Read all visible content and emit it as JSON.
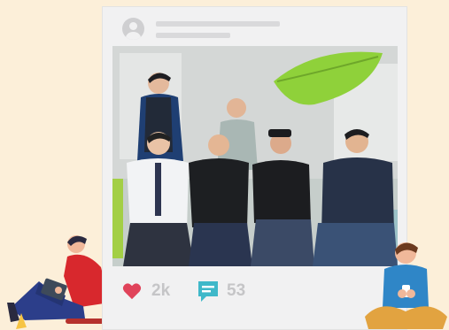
{
  "post": {
    "likes": "2k",
    "comments": "53"
  },
  "icons": {
    "avatar": "user-avatar-icon",
    "like": "heart-icon",
    "comment": "comment-icon"
  },
  "colors": {
    "background": "#fcefd9",
    "card": "#f1f1f2",
    "heart": "#e0435a",
    "comment": "#3fb8c9",
    "counts": "#c5c5c7"
  }
}
